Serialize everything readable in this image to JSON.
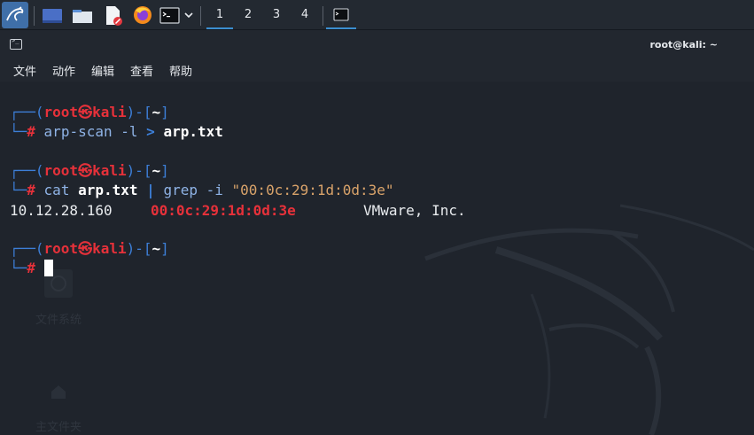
{
  "workspaces": [
    "1",
    "2",
    "3",
    "4"
  ],
  "window": {
    "title": "root@kali: ~"
  },
  "menu": [
    "文件",
    "动作",
    "编辑",
    "查看",
    "帮助"
  ],
  "prompt": {
    "open": "┌──(",
    "user": "root",
    "at": "㉿",
    "host": "kali",
    "mid": ")-[",
    "dir": "~",
    "close": "]",
    "corner": "└─",
    "hash": "#"
  },
  "commands": {
    "c1_name": "arp-scan",
    "c1_flag": "-l",
    "c1_op": ">",
    "c1_file": "arp.txt",
    "c2_name": "cat",
    "c2_file": "arp.txt",
    "c2_pipe": "|",
    "c2_grep": "grep",
    "c2_flag": "-i",
    "c2_pattern": "\"00:0c:29:1d:0d:3e\""
  },
  "output": {
    "ip": "10.12.28.160",
    "mac": "00:0c:29:1d:0d:3e",
    "vendor": "VMware, Inc."
  },
  "desktop": {
    "ghost1": "文件系统",
    "ghost2": "主文件夹"
  },
  "colors": {
    "accent": "#3b8ed0",
    "prompt_blue": "#3d7fd8",
    "prompt_red": "#e6313a",
    "string": "#d9a36a"
  }
}
